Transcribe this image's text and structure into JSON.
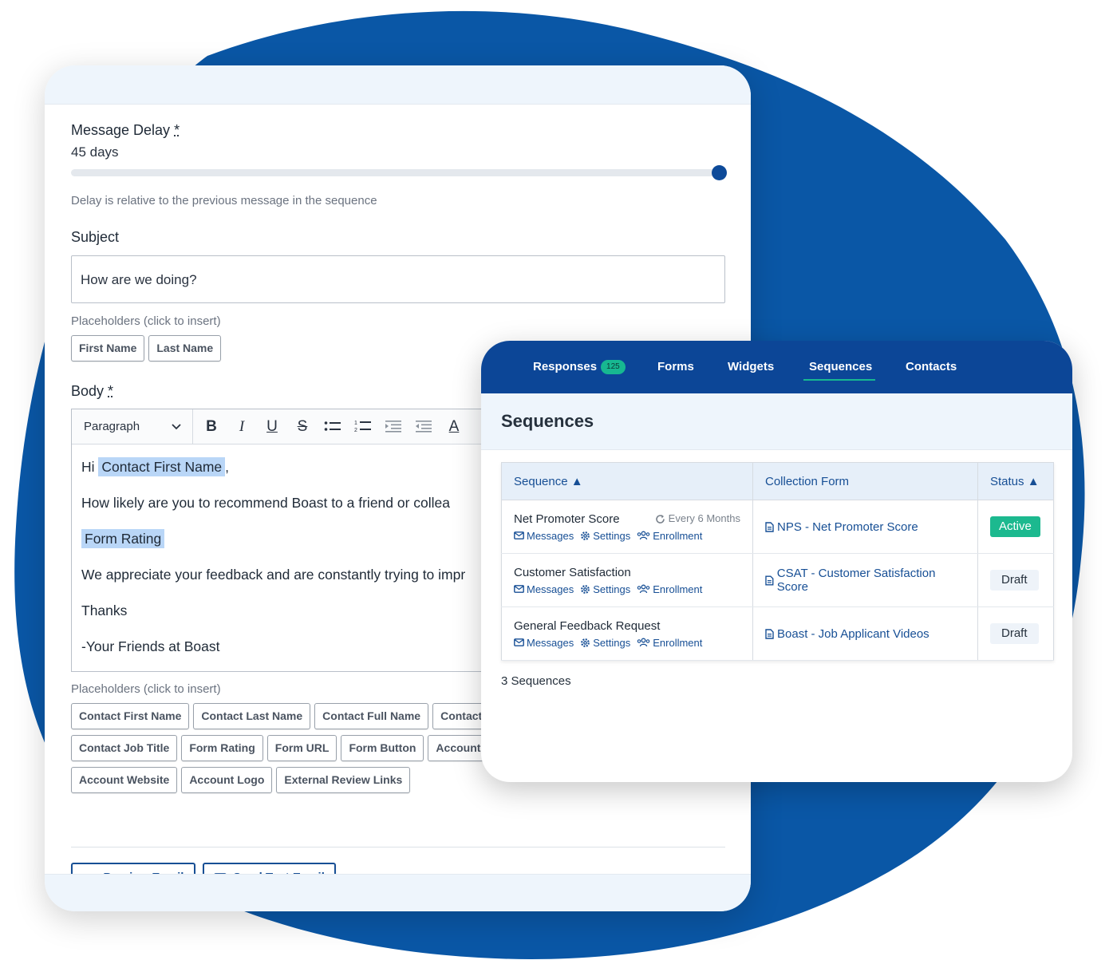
{
  "editor": {
    "message_delay_label": "Message Delay",
    "required_mark": "*",
    "message_delay_value": "45 days",
    "slider_fraction": 1.0,
    "delay_help": "Delay is relative to the previous message in the sequence",
    "subject_label": "Subject",
    "subject_value": "How are we doing?",
    "placeholders_label": "Placeholders (click to insert)",
    "subject_chips": [
      "First Name",
      "Last Name"
    ],
    "body_label": "Body",
    "format_select": "Paragraph",
    "toolbar_icons": [
      "bold-icon",
      "italic-icon",
      "underline-icon",
      "strikethrough-icon",
      "bulleted-list-icon",
      "numbered-list-icon",
      "indent-icon",
      "outdent-icon",
      "font-color-icon"
    ],
    "body": {
      "greeting_prefix": "Hi",
      "greeting_token": "Contact First Name",
      "greeting_suffix": ",",
      "question": "How likely are you to recommend Boast to a friend or collea",
      "rating_token": "Form Rating",
      "appreciation": "We appreciate your feedback and are constantly trying to impr",
      "thanks": "Thanks",
      "signature": "-Your Friends at Boast"
    },
    "body_chips": [
      "Contact First Name",
      "Contact Last Name",
      "Contact Full Name",
      "Contact I",
      "Contact Job Title",
      "Form Rating",
      "Form URL",
      "Form Button",
      "Account Co",
      "Account Website",
      "Account Logo",
      "External Review Links"
    ],
    "preview_button": "Preview Email",
    "send_test_button": "Send Test Email"
  },
  "sequences": {
    "nav": [
      {
        "label": "Responses",
        "badge": "125"
      },
      {
        "label": "Forms"
      },
      {
        "label": "Widgets"
      },
      {
        "label": "Sequences",
        "active": true
      },
      {
        "label": "Contacts"
      }
    ],
    "title": "Sequences",
    "columns": [
      "Sequence ▲",
      "Collection Form",
      "Status ▲"
    ],
    "rows": [
      {
        "name": "Net Promoter Score",
        "frequency": "Every 6 Months",
        "links": [
          "Messages",
          "Settings",
          "Enrollment"
        ],
        "form": "NPS - Net Promoter Score",
        "status": "Active"
      },
      {
        "name": "Customer Satisfaction",
        "links": [
          "Messages",
          "Settings",
          "Enrollment"
        ],
        "form": "CSAT - Customer Satisfaction Score",
        "status": "Draft"
      },
      {
        "name": "General Feedback Request",
        "links": [
          "Messages",
          "Settings",
          "Enrollment"
        ],
        "form": "Boast - Job Applicant Videos",
        "status": "Draft"
      }
    ],
    "count_text": "3 Sequences"
  },
  "colors": {
    "brand_blue": "#0c4697",
    "link_blue": "#174f95",
    "active_green": "#1cb98f",
    "highlight": "#b9d6f7"
  }
}
